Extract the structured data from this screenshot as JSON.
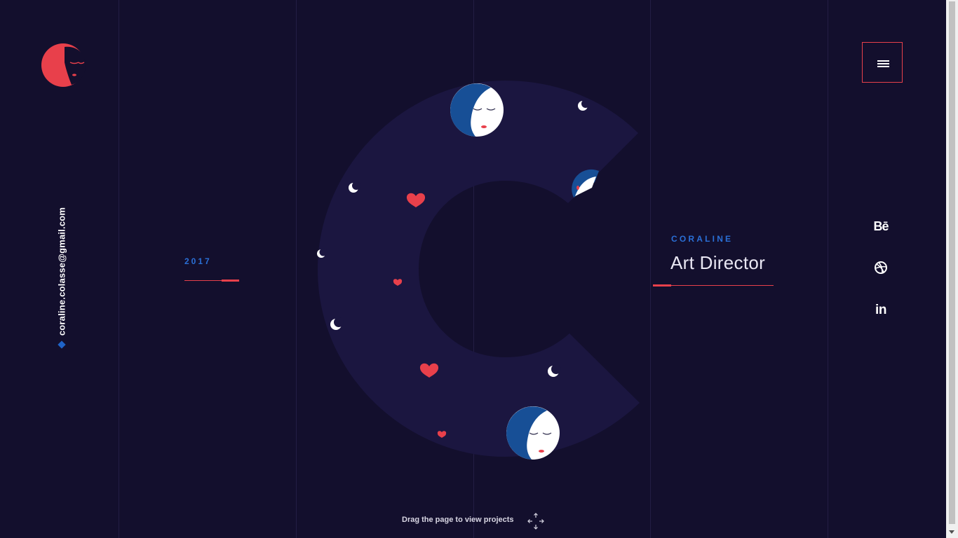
{
  "brand": {
    "email": "coraline.colasse@gmail.com",
    "accent_color": "#e8404b",
    "blue_color": "#2a6fd6",
    "background_color": "#130f2d"
  },
  "year": "2017",
  "hero": {
    "subtitle": "CORALINE",
    "title": "Art Director"
  },
  "social": {
    "behance_label": "Bē",
    "linkedin_label": "in",
    "dribbble_icon": "dribbble-icon"
  },
  "menu": {
    "icon": "hamburger-icon"
  },
  "hint": {
    "text": "Drag the page to view projects",
    "icon": "move-arrows-icon"
  }
}
